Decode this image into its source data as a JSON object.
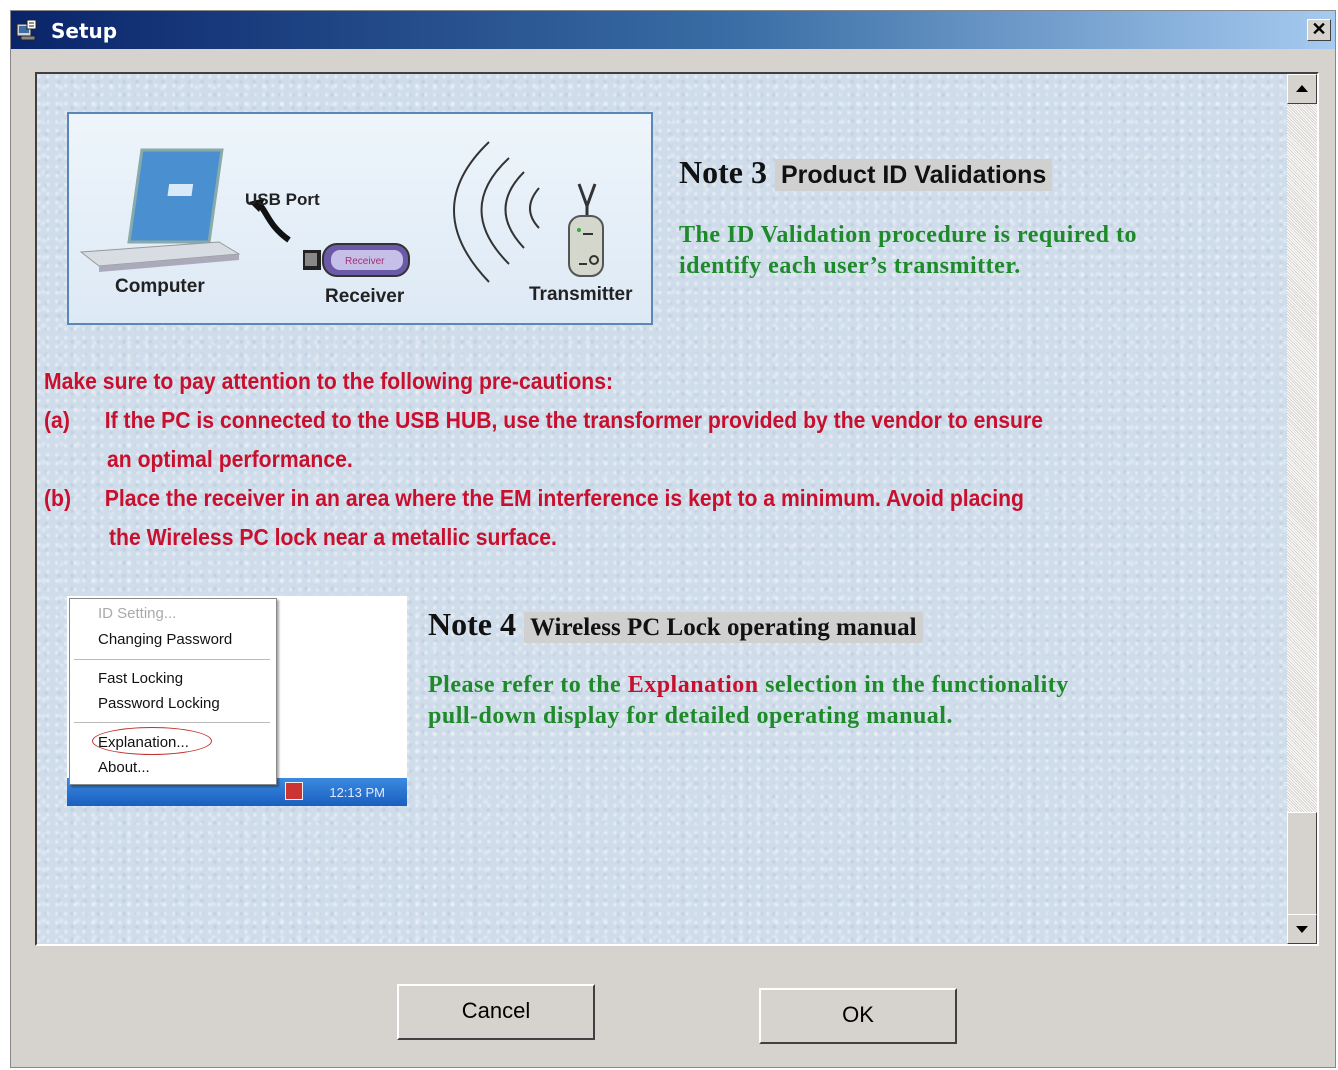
{
  "window": {
    "title": "Setup",
    "close_label": "✕"
  },
  "diagram": {
    "usb_port": "USB Port",
    "computer": "Computer",
    "receiver": "Receiver",
    "receiver_device": "Receiver",
    "transmitter": "Transmitter"
  },
  "note3": {
    "label": "Note 3",
    "heading": "Product ID Validations",
    "lines": [
      "The ID Validation procedure is required to",
      "identify each user’s transmitter."
    ]
  },
  "cautions": {
    "heading": "Make sure to pay attention to the following pre-cautions:",
    "items": [
      {
        "marker": "(a)",
        "lines": [
          "If the PC is connected to the USB HUB, use the transformer provided by the vendor to ensure",
          "an optimal performance."
        ]
      },
      {
        "marker": "(b)",
        "lines": [
          "Place the receiver in an area where the EM interference is kept to a minimum. Avoid placing",
          "the Wireless PC lock near a metallic surface."
        ]
      }
    ]
  },
  "menu_shot": {
    "items": [
      "ID Setting...",
      "Changing Password",
      "Fast Locking",
      "Password Locking",
      "Explanation...",
      "About..."
    ],
    "clock": "12:13 PM"
  },
  "note4": {
    "label": "Note 4",
    "heading": "Wireless PC Lock operating manual",
    "line1_before": "Please refer to the ",
    "line1_highlight": "Explanation",
    "line1_after": " selection in the functionality",
    "line2": "pull-down display for detailed operating manual."
  },
  "buttons": {
    "cancel": "Cancel",
    "ok": "OK"
  },
  "colors": {
    "note_text": "#1e8a2a",
    "caution_text": "#c8102e",
    "title_bar": "#0a246a"
  }
}
